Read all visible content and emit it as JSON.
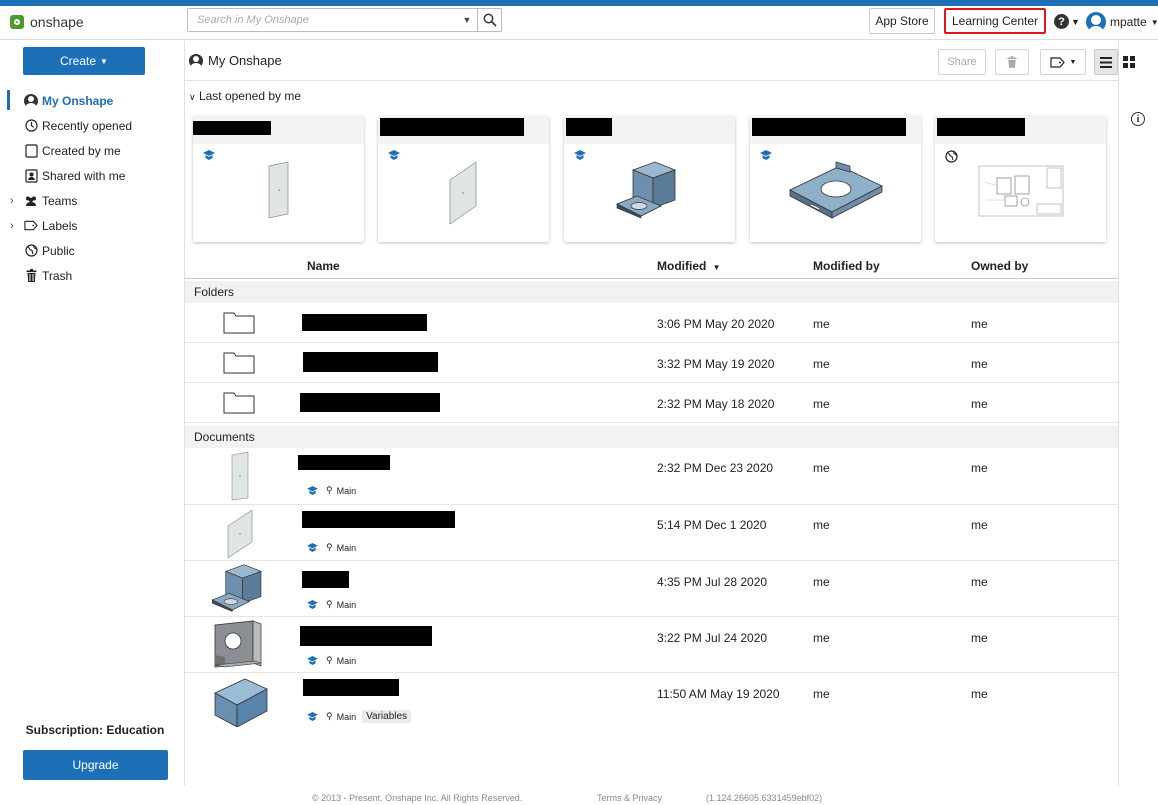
{
  "app": {
    "name": "onshape"
  },
  "search": {
    "placeholder": "Search in My Onshape"
  },
  "topbar": {
    "app_store": "App Store",
    "learning_center": "Learning Center",
    "username": "mpatte"
  },
  "sidebar": {
    "create_label": "Create",
    "items": [
      {
        "label": "My Onshape",
        "icon": "user-circle-icon"
      },
      {
        "label": "Recently opened",
        "icon": "clock-icon"
      },
      {
        "label": "Created by me",
        "icon": "document-icon"
      },
      {
        "label": "Shared with me",
        "icon": "shared-icon"
      },
      {
        "label": "Teams",
        "icon": "teams-icon"
      },
      {
        "label": "Labels",
        "icon": "label-icon"
      },
      {
        "label": "Public",
        "icon": "globe-icon"
      },
      {
        "label": "Trash",
        "icon": "trash-icon"
      }
    ],
    "subscription": "Subscription: Education",
    "upgrade_label": "Upgrade"
  },
  "main": {
    "title": "My Onshape",
    "share_label": "Share",
    "recent_section": "Last opened by me",
    "columns": {
      "name": "Name",
      "modified": "Modified",
      "modified_by": "Modified by",
      "owned_by": "Owned by"
    },
    "folders_label": "Folders",
    "documents_label": "Documents",
    "folders": [
      {
        "modified": "3:06 PM May 20 2020",
        "modified_by": "me",
        "owned_by": "me"
      },
      {
        "modified": "3:32 PM May 19 2020",
        "modified_by": "me",
        "owned_by": "me"
      },
      {
        "modified": "2:32 PM May 18 2020",
        "modified_by": "me",
        "owned_by": "me"
      }
    ],
    "documents": [
      {
        "modified": "2:32 PM Dec 23 2020",
        "modified_by": "me",
        "owned_by": "me",
        "branch": "Main",
        "tag": ""
      },
      {
        "modified": "5:14 PM Dec 1 2020",
        "modified_by": "me",
        "owned_by": "me",
        "branch": "Main",
        "tag": ""
      },
      {
        "modified": "4:35 PM Jul 28 2020",
        "modified_by": "me",
        "owned_by": "me",
        "branch": "Main",
        "tag": ""
      },
      {
        "modified": "3:22 PM Jul 24 2020",
        "modified_by": "me",
        "owned_by": "me",
        "branch": "Main",
        "tag": ""
      },
      {
        "modified": "11:50 AM May 19 2020",
        "modified_by": "me",
        "owned_by": "me",
        "branch": "Main",
        "tag": "Variables"
      }
    ]
  },
  "footer": {
    "copyright": "© 2013 - Present. Onshape Inc. All Rights Reserved.",
    "terms": "Terms & Privacy",
    "version": "(1.124.26605.6331459ebf02)"
  },
  "colors": {
    "accent": "#1d6fb8",
    "highlight_border": "#e0161b"
  }
}
